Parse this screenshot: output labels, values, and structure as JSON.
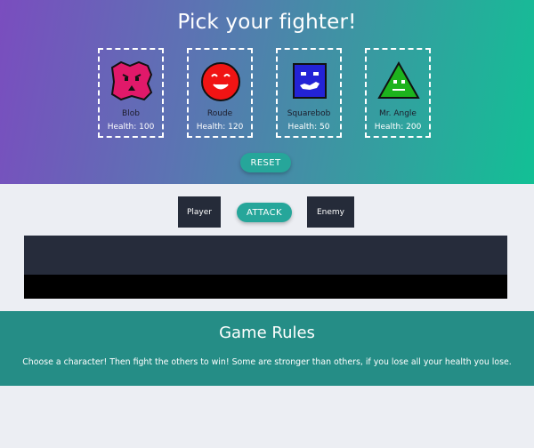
{
  "header": {
    "title": "Pick your fighter!"
  },
  "fighters": [
    {
      "name": "Blob",
      "health_label": "Health: 100",
      "icon": "blob-monster-icon",
      "color": "#e1196a"
    },
    {
      "name": "Roude",
      "health_label": "Health: 120",
      "icon": "red-circle-face-icon",
      "color": "#f01414"
    },
    {
      "name": "Squarebob",
      "health_label": "Health: 50",
      "icon": "blue-square-face-icon",
      "color": "#2323d6"
    },
    {
      "name": "Mr. Angle",
      "health_label": "Health: 200",
      "icon": "green-triangle-face-icon",
      "color": "#1db31d"
    }
  ],
  "controls": {
    "reset_label": "RESET",
    "attack_label": "ATTACK",
    "player_label": "Player",
    "enemy_label": "Enemy"
  },
  "rules": {
    "title": "Game Rules",
    "text": "Choose a character! Then fight the others to win! Some are stronger than others, if you lose all your health you lose."
  },
  "colors": {
    "accent": "#26a69a",
    "rules_bg": "#258d86",
    "arena": "#262c3b"
  }
}
